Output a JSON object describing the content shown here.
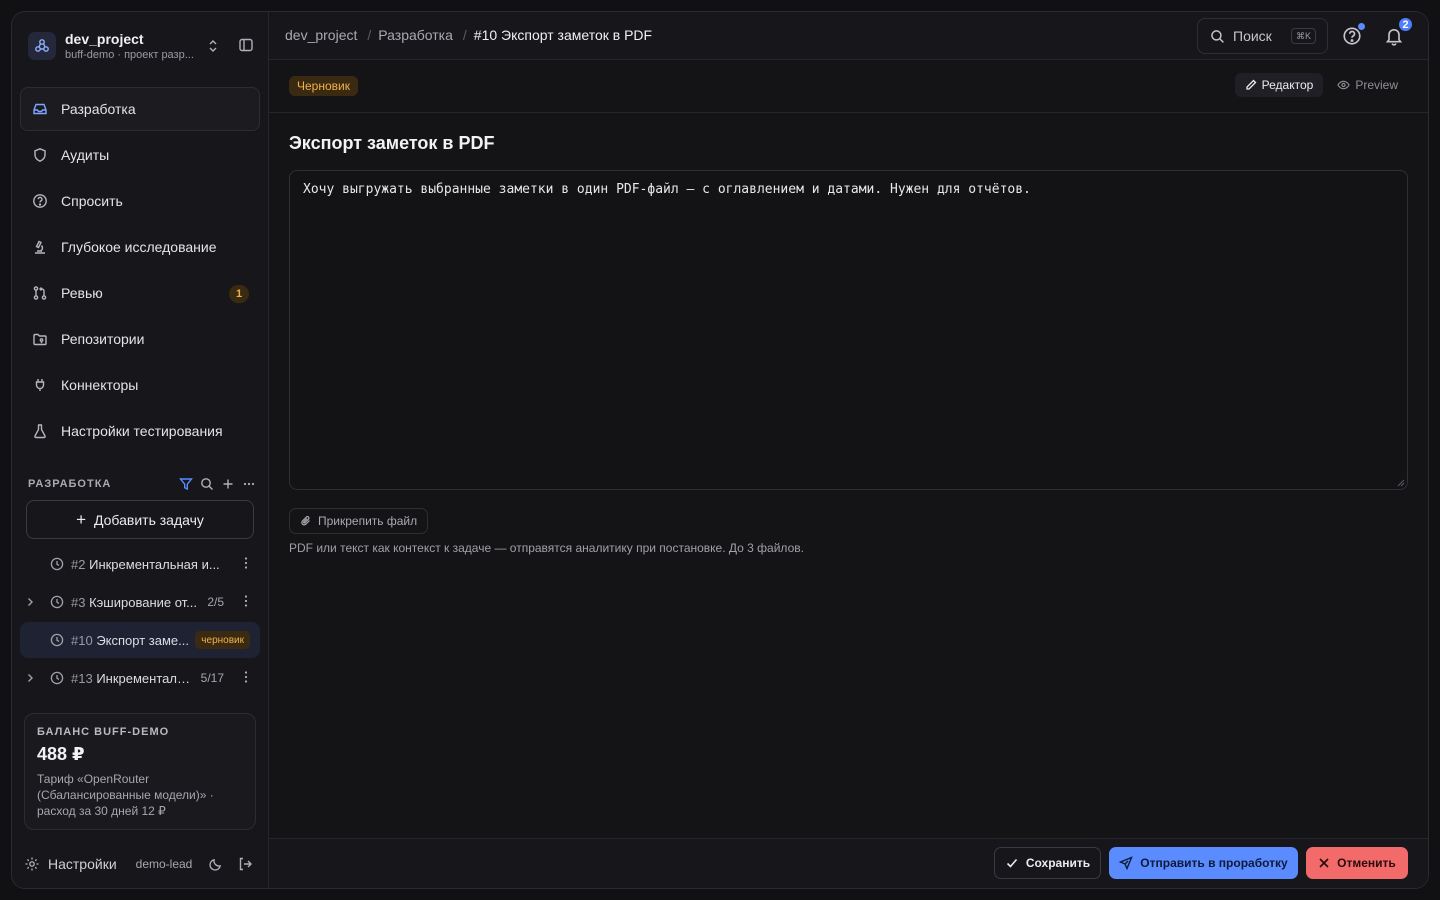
{
  "sidebar": {
    "project": {
      "name": "dev_project",
      "subtitle": "buff-demo · проект разр..."
    },
    "nav": [
      {
        "label": "Разработка",
        "icon": "inbox-icon",
        "active": true
      },
      {
        "label": "Аудиты",
        "icon": "shield-icon"
      },
      {
        "label": "Спросить",
        "icon": "help-circle-icon"
      },
      {
        "label": "Глубокое исследование",
        "icon": "microscope-icon"
      },
      {
        "label": "Ревью",
        "icon": "git-pull-request-icon",
        "badge": "1"
      },
      {
        "label": "Репозитории",
        "icon": "folder-git-icon"
      },
      {
        "label": "Коннекторы",
        "icon": "plug-icon"
      },
      {
        "label": "Настройки тестирования",
        "icon": "flask-icon"
      }
    ],
    "section_title": "РАЗРАБОТКА",
    "add_task_label": "Добавить задачу",
    "tasks": [
      {
        "num": "#2",
        "title": "Инкрементальная и...",
        "progress": "",
        "expandable": false
      },
      {
        "num": "#3",
        "title": "Кэширование от...",
        "progress": "2/5",
        "expandable": true
      },
      {
        "num": "#10",
        "title": "Экспорт заме...",
        "progress": "",
        "badge": "черновик",
        "active": true,
        "expandable": false
      },
      {
        "num": "#13",
        "title": "Инкременталь...",
        "progress": "5/17",
        "expandable": true
      }
    ],
    "balance": {
      "title": "БАЛАНС BUFF-DEMO",
      "amount": "488 ₽",
      "description": "Тариф «OpenRouter (Сбалансированные модели)» · расход за 30 дней 12 ₽"
    },
    "footer": {
      "settings_label": "Настройки",
      "user": "demo-lead"
    }
  },
  "header": {
    "breadcrumbs": [
      "dev_project",
      "Разработка",
      "#10 Экспорт заметок в PDF"
    ],
    "search_label": "Поиск",
    "search_shortcut": "⌘K",
    "notifications_count": "2"
  },
  "task": {
    "status_badge": "Черновик",
    "mode_tabs": {
      "editor": "Редактор",
      "preview": "Preview"
    },
    "title": "Экспорт заметок в PDF",
    "description": "Хочу выгружать выбранные заметки в один PDF-файл — с оглавлением и датами. Нужен для отчётов.",
    "attach_label": "Прикрепить файл",
    "attach_hint": "PDF или текст как контекст к задаче — отправятся аналитику при постановке. До 3 файлов."
  },
  "actions": {
    "save": "Сохранить",
    "send": "Отправить в проработку",
    "cancel": "Отменить"
  },
  "colors": {
    "accent": "#5b8cff",
    "danger": "#f26a6a",
    "draft_bg": "#3a2a12",
    "draft_fg": "#f0b14a"
  }
}
